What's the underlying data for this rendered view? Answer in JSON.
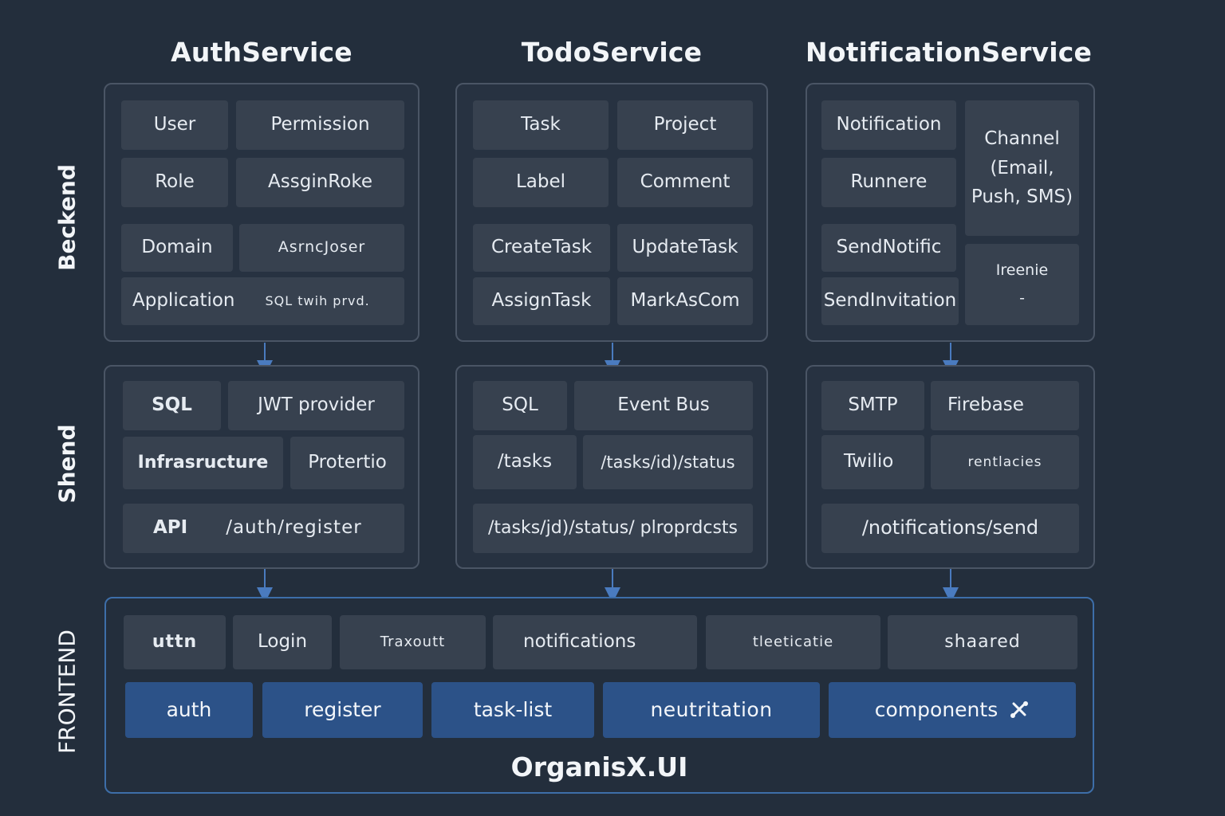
{
  "services": {
    "auth": "AuthService",
    "todo": "TodoService",
    "notification": "NotificationService"
  },
  "layers": {
    "backend": "Beckend",
    "shared": "Shend",
    "frontend": "FRONTEND"
  },
  "auth_backend": {
    "user": "User",
    "permission": "Permission",
    "role": "Role",
    "assign_role": "AssginRoke",
    "domain": "Domain",
    "async_user": "AsrncJoser",
    "application": "Application",
    "sql_jwt": "SQL  twih prvd."
  },
  "todo_backend": {
    "task": "Task",
    "project": "Project",
    "label": "Label",
    "comment": "Comment",
    "create_task": "CreateTask",
    "update_task": "UpdateTask",
    "assign_task": "AssignTask",
    "mark_complete": "MarkAsCom"
  },
  "notif_backend": {
    "notification": "Notification",
    "channel": "Channel (Email, Push, SMS)",
    "runner": "Runnere",
    "send_notific": "SendNotific",
    "ireenie": "Ireenie",
    "dash": "-",
    "send_invitation": "SendInvitation"
  },
  "auth_shared": {
    "sql": "SQL",
    "jwt": "JWT provider",
    "infra": "Infrasructure",
    "protertio": "Protertio",
    "api": "API",
    "register_route": "/auth/register"
  },
  "todo_shared": {
    "sql": "SQL",
    "event_bus": "Event Bus",
    "tasks_route": "/tasks",
    "tasks_status_route": "/tasks/id)/status",
    "tasks_status_products": "/tasks/jd)/status/ plroprdcsts"
  },
  "notif_shared": {
    "smtp": "SMTP",
    "firebase": "Firebase",
    "twilio": "Twilio",
    "renttacies": "rentlacies",
    "send_route": "/notifications/send"
  },
  "frontend_top": [
    "uttn",
    "Login",
    "Traxoutt",
    "notifications",
    "tleeticatie",
    "shaared"
  ],
  "frontend_modules": [
    "auth",
    "register",
    "task-list",
    "neutritation",
    "components"
  ],
  "app_name": "OrganisX.UI",
  "colors": {
    "background": "#232e3c",
    "cell": "#37414f",
    "module_blue": "#2c5288",
    "arrow": "#4a7bbf"
  }
}
